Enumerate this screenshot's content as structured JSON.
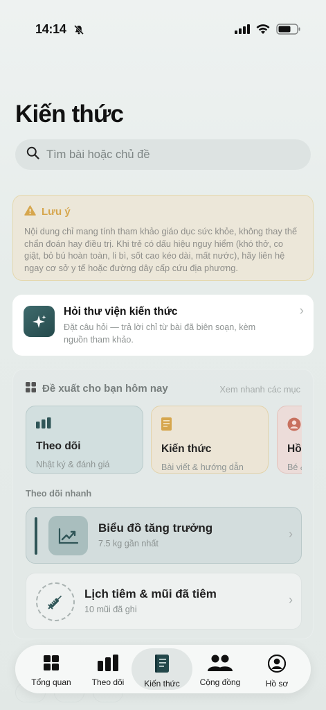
{
  "status_bar": {
    "time": "14:14"
  },
  "page": {
    "title": "Kiến thức"
  },
  "search": {
    "placeholder": "Tìm bài hoặc chủ đề"
  },
  "notice": {
    "title": "Lưu ý",
    "body": "Nội dung chỉ mang tính tham khảo giáo dục sức khỏe, không thay thế chẩn đoán hay điều trị. Khi trẻ có dấu hiệu nguy hiểm (khó thở, co giật, bỏ bú hoàn toàn, li bì, sốt cao kéo dài, mất nước), hãy liên hệ ngay cơ sở y tế hoặc đường dây cấp cứu địa phương.",
    "color": "#d6a64d"
  },
  "ask_card": {
    "title": "Hỏi thư viện kiến thức",
    "description": "Đặt câu hỏi — trả lời chỉ từ bài đã biên soạn, kèm nguồn tham khảo."
  },
  "suggestions": {
    "title": "Đề xuất cho bạn hôm nay",
    "link": "Xem nhanh các mục",
    "cards": [
      {
        "title": "Theo dõi",
        "subtitle": "Nhật ký & đánh giá",
        "icon": "bar-chart-icon",
        "color": "#2f5557"
      },
      {
        "title": "Kiến thức",
        "subtitle": "Bài viết & hướng dẫn",
        "icon": "book-icon",
        "color": "#d6a64d"
      },
      {
        "title": "Hồ",
        "subtitle": "Bé &",
        "icon": "profile-icon",
        "color": "#c8705e"
      }
    ],
    "quick_label": "Theo dõi nhanh",
    "quick_items": [
      {
        "title": "Biểu đồ tăng trưởng",
        "subtitle": "7.5 kg gần nhất"
      },
      {
        "title": "Lịch tiêm & mũi đã tiêm",
        "subtitle": "10 mũi đã ghi"
      }
    ]
  },
  "tabbar": {
    "items": [
      {
        "label": "Tổng quan"
      },
      {
        "label": "Theo dõi"
      },
      {
        "label": "Kiến thức"
      },
      {
        "label": "Cộng đồng"
      },
      {
        "label": "Hồ sơ"
      }
    ],
    "active": "Kiến thức"
  }
}
